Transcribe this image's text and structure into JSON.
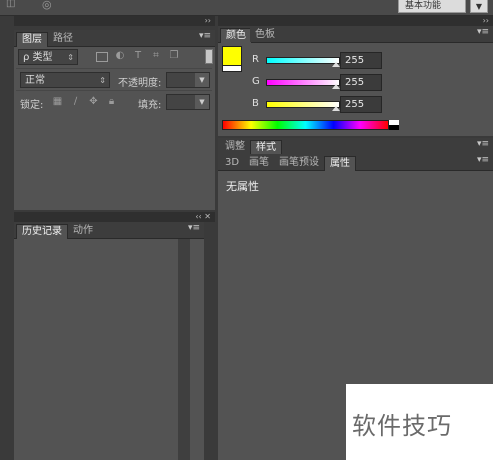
{
  "topbar": {
    "workspace_label": "基本功能"
  },
  "layers_panel": {
    "tabs": [
      {
        "label": "图层",
        "active": true
      },
      {
        "label": "路径",
        "active": false
      }
    ],
    "filter": {
      "search_prefix": "ρ",
      "kind": "类型"
    },
    "blend_mode": "正常",
    "opacity_label": "不透明度:",
    "lock_label": "锁定:",
    "fill_label": "填充:"
  },
  "history_panel": {
    "tabs": [
      {
        "label": "历史记录",
        "active": true
      },
      {
        "label": "动作",
        "active": false
      }
    ]
  },
  "color_panel": {
    "tabs": [
      {
        "label": "颜色",
        "active": true
      },
      {
        "label": "色板",
        "active": false
      }
    ],
    "foreground": "#ffff00",
    "background": "#ffffff",
    "channels": [
      {
        "label": "R",
        "value": "255"
      },
      {
        "label": "G",
        "value": "255"
      },
      {
        "label": "B",
        "value": "255"
      }
    ]
  },
  "adjust_panel": {
    "tabs": [
      {
        "label": "调整",
        "active": false
      },
      {
        "label": "样式",
        "active": true
      }
    ]
  },
  "properties_panel": {
    "tabs": [
      {
        "label": "3D",
        "active": false
      },
      {
        "label": "画笔",
        "active": false
      },
      {
        "label": "画笔预设",
        "active": false
      },
      {
        "label": "属性",
        "active": true
      }
    ],
    "empty_text": "无属性"
  },
  "watermark": {
    "text": "软件技巧"
  }
}
